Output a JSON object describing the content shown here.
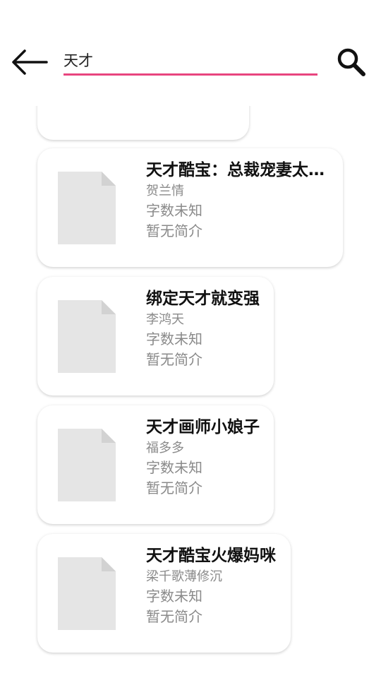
{
  "search": {
    "query": "天才"
  },
  "results": [
    {
      "title": "天才酷宝：总裁宠妻太甜蜜",
      "author": "贺兰情",
      "word_count": "字数未知",
      "intro": "暂无简介"
    },
    {
      "title": "绑定天才就变强",
      "author": "李鸿天",
      "word_count": "字数未知",
      "intro": "暂无简介"
    },
    {
      "title": "天才画师小娘子",
      "author": "福多多",
      "word_count": "字数未知",
      "intro": "暂无简介"
    },
    {
      "title": "天才酷宝火爆妈咪",
      "author": "梁千歌薄修沉",
      "word_count": "字数未知",
      "intro": "暂无简介"
    }
  ],
  "colors": {
    "accent": "#e8457f",
    "placeholder_cover": "#e5e5e5",
    "secondary_text": "#8a8a8a"
  },
  "icons": {
    "back": "arrow-left-icon",
    "search": "search-icon",
    "cover": "document-placeholder-icon"
  }
}
